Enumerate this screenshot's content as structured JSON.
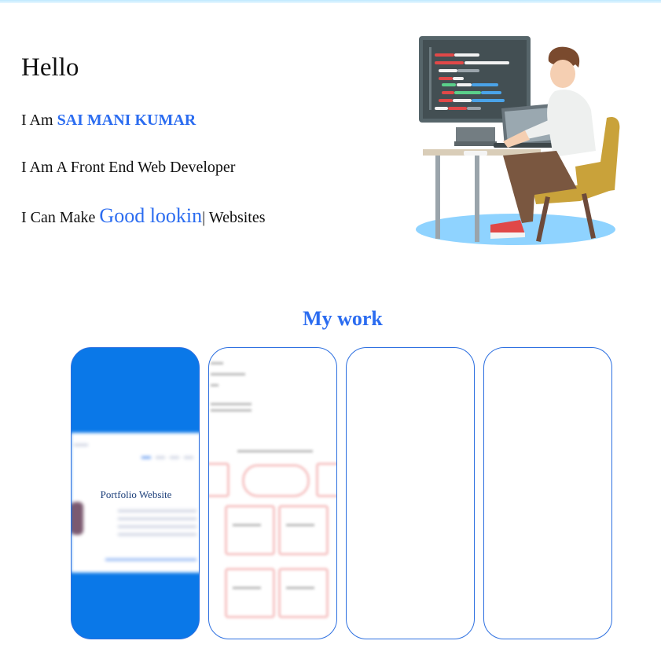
{
  "hero": {
    "greeting": "Hello",
    "intro_prefix": "I Am ",
    "name": "SAI MANI KUMAR",
    "role": "I Am A Front End Web Developer",
    "make_prefix": "I Can Make ",
    "typed_text": "Good lookin",
    "cursor": "|",
    "make_suffix": " Websites"
  },
  "work": {
    "title": "My work",
    "cards": [
      {
        "label": "Portfolio Website"
      },
      {
        "label": ""
      },
      {
        "label": ""
      },
      {
        "label": ""
      }
    ]
  },
  "colors": {
    "accent": "#2b6cf0",
    "card_border": "#2c6fe0",
    "card1_bg": "#0a78e8"
  }
}
